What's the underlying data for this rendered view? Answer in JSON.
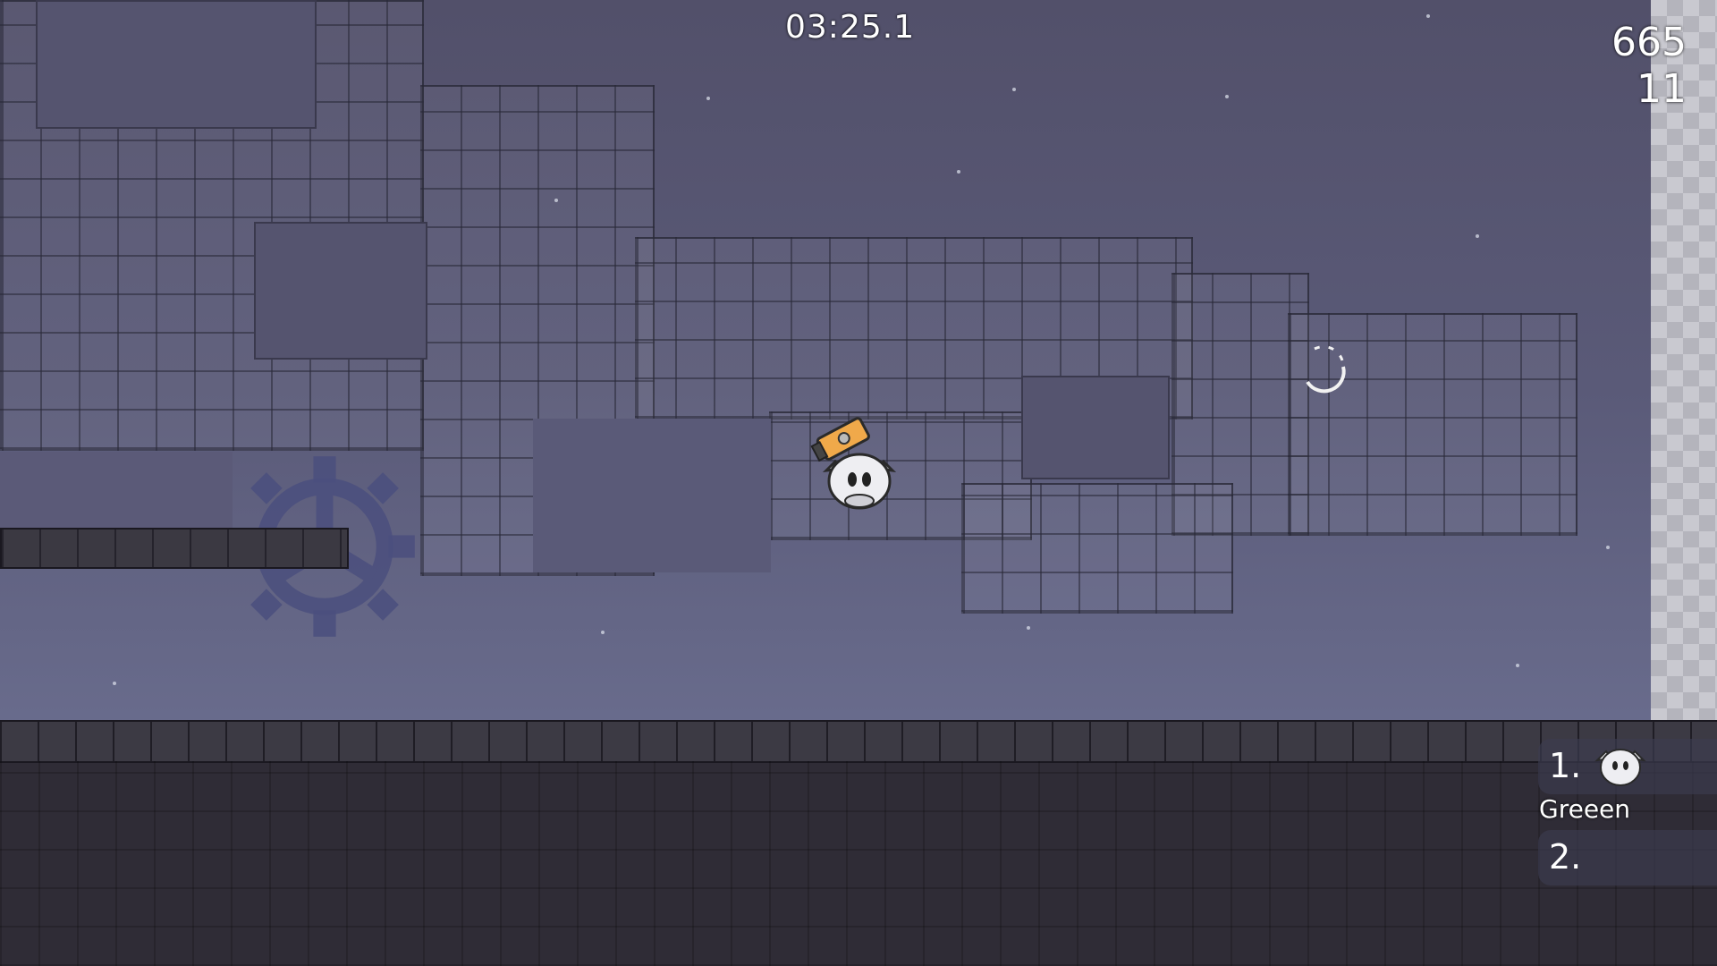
{
  "hud": {
    "timer": "03:25.1",
    "score": "665",
    "count": "11"
  },
  "scoreboard": {
    "entries": [
      {
        "rank": "1.",
        "name": "Greeen"
      },
      {
        "rank": "2.",
        "name": ""
      }
    ]
  },
  "colors": {
    "sky_top": "#52506a",
    "sky_bottom": "#6e7294",
    "floor": "#2f2c36",
    "hammer": "#f0a94a"
  },
  "icons": {
    "player": "tee-character-icon",
    "hammer": "hammer-icon",
    "gear": "gear-icon",
    "hook": "grappling-hook-icon"
  }
}
